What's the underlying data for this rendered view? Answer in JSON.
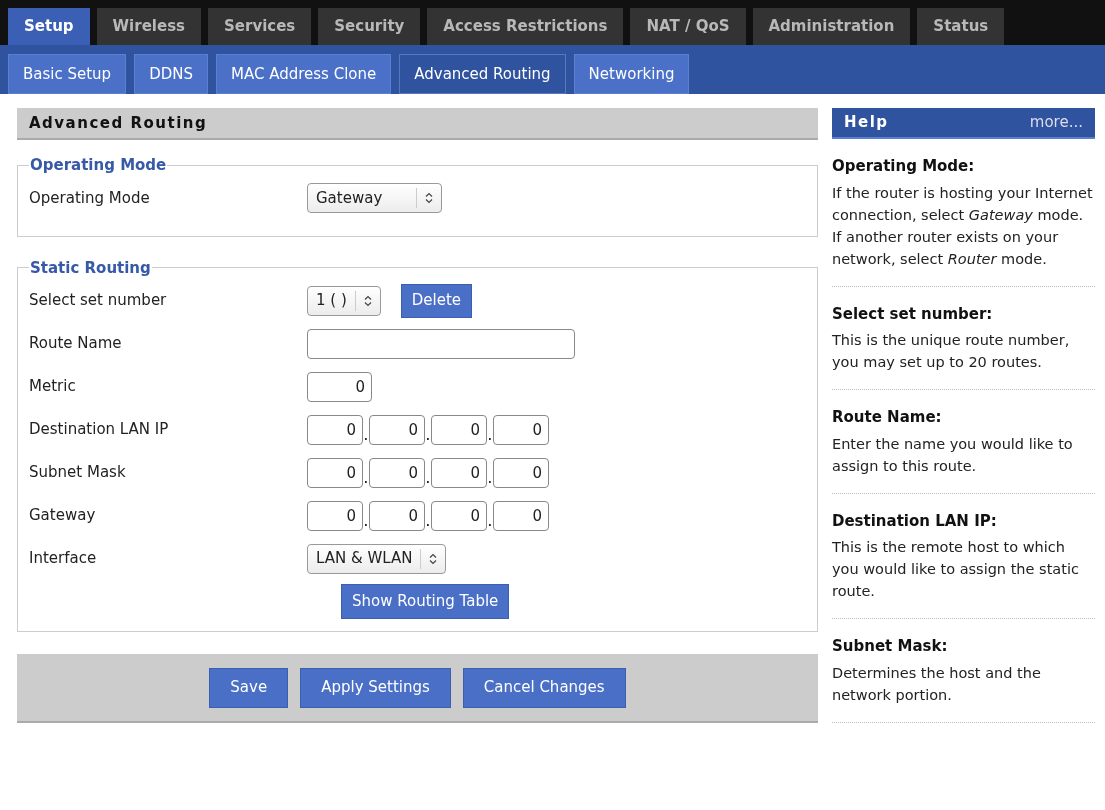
{
  "main_tabs": [
    {
      "label": "Setup",
      "selected": true
    },
    {
      "label": "Wireless",
      "selected": false
    },
    {
      "label": "Services",
      "selected": false
    },
    {
      "label": "Security",
      "selected": false
    },
    {
      "label": "Access Restrictions",
      "selected": false
    },
    {
      "label": "NAT / QoS",
      "selected": false
    },
    {
      "label": "Administration",
      "selected": false
    },
    {
      "label": "Status",
      "selected": false
    }
  ],
  "sub_tabs": [
    {
      "label": "Basic Setup",
      "selected": false
    },
    {
      "label": "DDNS",
      "selected": false
    },
    {
      "label": "MAC Address Clone",
      "selected": false
    },
    {
      "label": "Advanced Routing",
      "selected": true
    },
    {
      "label": "Networking",
      "selected": false
    }
  ],
  "page_title": "Advanced Routing",
  "sections": [
    {
      "legend": "Operating Mode",
      "rows": [
        {
          "kind": "select",
          "label": "Operating Mode",
          "value": "Gateway"
        }
      ]
    },
    {
      "legend": "Static Routing",
      "rows": [
        {
          "kind": "select",
          "label": "Select set number",
          "value": "1 ( )",
          "button": "Delete"
        },
        {
          "kind": "text",
          "label": "Route Name",
          "value": ""
        },
        {
          "kind": "number",
          "label": "Metric",
          "value": "0"
        },
        {
          "kind": "ip",
          "label": "Destination LAN IP",
          "octets": [
            "0",
            "0",
            "0",
            "0"
          ],
          "separator": "."
        },
        {
          "kind": "ip",
          "label": "Subnet Mask",
          "octets": [
            "0",
            "0",
            "0",
            "0"
          ],
          "separator": "."
        },
        {
          "kind": "ip",
          "label": "Gateway",
          "octets": [
            "0",
            "0",
            "0",
            "0"
          ],
          "separator": "."
        },
        {
          "kind": "select",
          "label": "Interface",
          "value": "LAN & WLAN"
        },
        {
          "kind": "action",
          "label": "Show Routing Table"
        }
      ]
    }
  ],
  "buttons": [
    "Save",
    "Apply Settings",
    "Cancel Changes"
  ],
  "help": {
    "title": "Help",
    "more": "more...",
    "entries": [
      {
        "title": "Operating Mode:",
        "text": "If the router is hosting your Internet connection, select *Gateway* mode. If another router exists on your network, select *Router* mode."
      },
      {
        "title": "Select set number:",
        "text": "This is the unique route number, you may set up to 20 routes."
      },
      {
        "title": "Route Name:",
        "text": "Enter the name you would like to assign to this route."
      },
      {
        "title": "Destination LAN IP:",
        "text": "This is the remote host to which you would like to assign the static route."
      },
      {
        "title": "Subnet Mask:",
        "text": "Determines the host and the network portion."
      }
    ]
  }
}
